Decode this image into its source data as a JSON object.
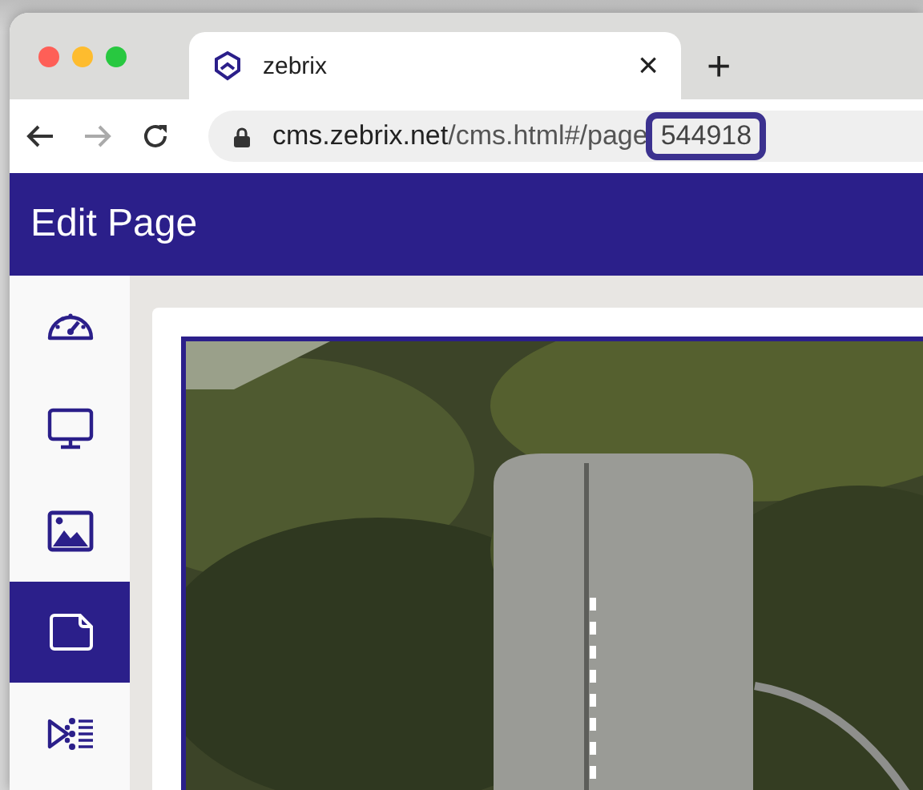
{
  "browser": {
    "tab": {
      "title": "zebrix",
      "close": "×"
    },
    "new_tab": "+",
    "url": {
      "host": "cms.zebrix.net",
      "path": "/cms.html#/page",
      "highlight": "544918"
    }
  },
  "header": {
    "title": "Edit Page"
  },
  "sidebar": {
    "items": [
      {
        "kind": "dashboard",
        "selected": false
      },
      {
        "kind": "display",
        "selected": false
      },
      {
        "kind": "media",
        "selected": false
      },
      {
        "kind": "page",
        "selected": true
      },
      {
        "kind": "playlist",
        "selected": false
      }
    ]
  }
}
